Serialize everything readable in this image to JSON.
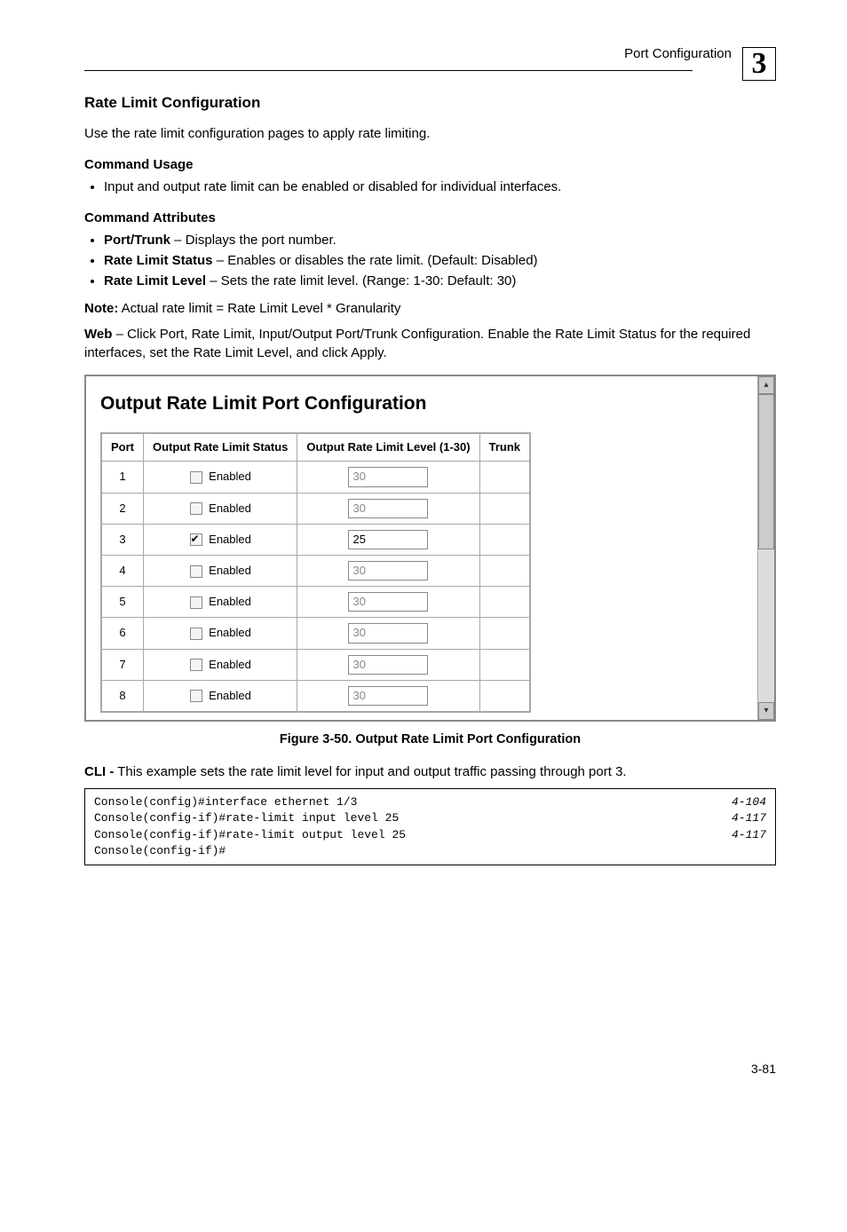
{
  "header": {
    "breadcrumb": "Port Configuration",
    "chapter": "3"
  },
  "section": {
    "title": "Rate Limit Configuration",
    "intro": "Use the rate limit configuration pages to apply rate limiting.",
    "usage_head": "Command Usage",
    "usage_item": "Input and output rate limit can be enabled or disabled for individual interfaces.",
    "attr_head": "Command Attributes",
    "attr_items": [
      {
        "term": "Port/Trunk",
        "desc": " – Displays the port number."
      },
      {
        "term": "Rate Limit Status",
        "desc": " – Enables or disables the rate limit. (Default: Disabled)"
      },
      {
        "term": "Rate Limit Level",
        "desc": " – Sets the rate limit level. (Range: 1-30: Default: 30)"
      }
    ],
    "note_label": "Note:",
    "note_text": " Actual rate limit = Rate Limit Level * Granularity",
    "web_bold": "Web",
    "web_text": " – Click Port, Rate Limit, Input/Output Port/Trunk Configuration. Enable the Rate Limit Status for the required interfaces, set the Rate Limit Level, and click Apply."
  },
  "screenshot": {
    "title": "Output Rate Limit Port Configuration",
    "cols": [
      "Port",
      "Output Rate Limit Status",
      "Output Rate Limit Level (1-30)",
      "Trunk"
    ],
    "enabled_label": "Enabled",
    "rows": [
      {
        "port": "1",
        "checked": false,
        "level": "30"
      },
      {
        "port": "2",
        "checked": false,
        "level": "30"
      },
      {
        "port": "3",
        "checked": true,
        "level": "25"
      },
      {
        "port": "4",
        "checked": false,
        "level": "30"
      },
      {
        "port": "5",
        "checked": false,
        "level": "30"
      },
      {
        "port": "6",
        "checked": false,
        "level": "30"
      },
      {
        "port": "7",
        "checked": false,
        "level": "30"
      },
      {
        "port": "8",
        "checked": false,
        "level": "30"
      }
    ]
  },
  "figure_caption": "Figure 3-50.  Output Rate Limit Port Configuration",
  "cli": {
    "lead_bold": "CLI -",
    "lead_text": " This example sets the rate limit level for input and output traffic passing through port 3.",
    "lines": [
      {
        "cmd": "Console(config)#interface ethernet 1/3",
        "ref": "4-104"
      },
      {
        "cmd": "Console(config-if)#rate-limit input level 25",
        "ref": "4-117"
      },
      {
        "cmd": "Console(config-if)#rate-limit output level 25",
        "ref": "4-117"
      },
      {
        "cmd": "Console(config-if)#",
        "ref": ""
      }
    ]
  },
  "page_number": "3-81"
}
